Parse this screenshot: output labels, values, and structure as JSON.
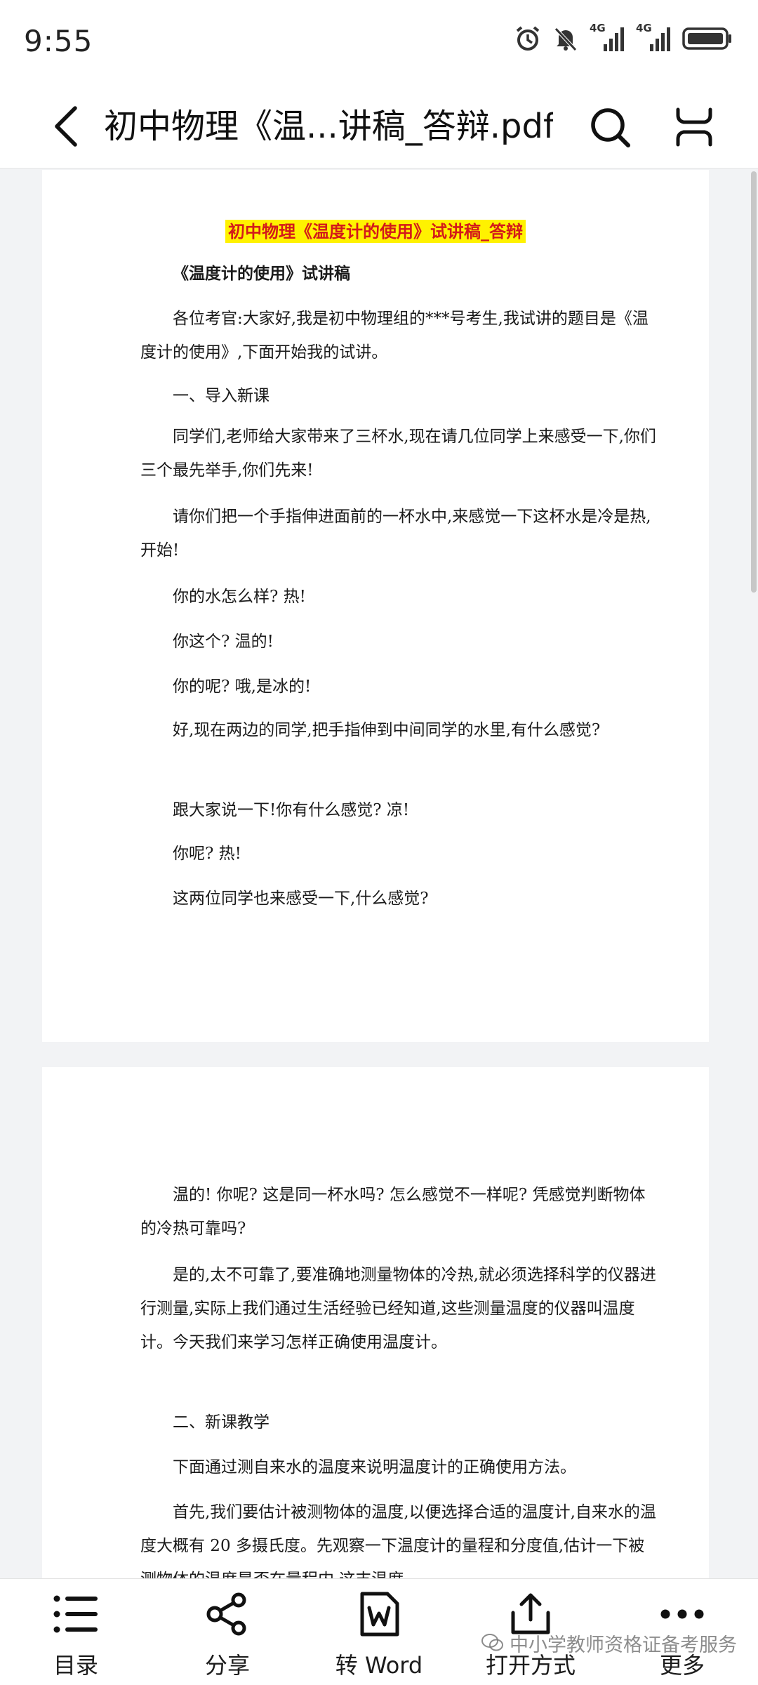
{
  "status_bar": {
    "time": "9:55",
    "net1": "4G",
    "net2": "4G",
    "icons": [
      "alarm-icon",
      "mute-icon",
      "signal-icon",
      "signal-icon",
      "battery-icon"
    ]
  },
  "header": {
    "title": "初中物理《温...讲稿_答辩.pdf"
  },
  "page1": {
    "heading": "初中物理《温度计的使用》试讲稿_答辩",
    "subheading": "《温度计的使用》试讲稿",
    "paragraphs": [
      "各位考官:大家好,我是初中物理组的***号考生,我试讲的题目是《温度计的使用》,下面开始我的试讲。",
      "一、导入新课",
      "同学们,老师给大家带来了三杯水,现在请几位同学上来感受一下,你们三个最先举手,你们先来!",
      "请你们把一个手指伸进面前的一杯水中,来感觉一下这杯水是冷是热,开始!",
      "你的水怎么样? 热!",
      "你这个? 温的!",
      "你的呢? 哦,是冰的!",
      "好,现在两边的同学,把手指伸到中间同学的水里,有什么感觉?",
      "跟大家说一下!你有什么感觉? 凉!",
      "你呢? 热!",
      "这两位同学也来感受一下,什么感觉?"
    ]
  },
  "page2": {
    "paragraphs": [
      "温的! 你呢? 这是同一杯水吗? 怎么感觉不一样呢? 凭感觉判断物体的冷热可靠吗?",
      "是的,太不可靠了,要准确地测量物体的冷热,就必须选择科学的仪器进行测量,实际上我们通过生活经验已经知道,这些测量温度的仪器叫温度计。今天我们来学习怎样正确使用温度计。",
      "二、新课教学",
      "下面通过测自来水的温度来说明温度计的正确使用方法。",
      "首先,我们要估计被测物体的温度,以便选择合适的温度计,自来水的温度大概有 20 多摄氏度。先观察一下温度计的量程和分度值,估计一下被测物体的温度是否在量程内,这支温度"
    ]
  },
  "toolbar": {
    "items": [
      {
        "label": "目录",
        "icon": "list-icon"
      },
      {
        "label": "分享",
        "icon": "share-icon"
      },
      {
        "label": "转 Word",
        "icon": "word-icon"
      },
      {
        "label": "打开方式",
        "icon": "open-with-icon"
      },
      {
        "label": "更多",
        "icon": "more-icon"
      }
    ]
  },
  "watermark": "中小学教师资格证备考服务"
}
